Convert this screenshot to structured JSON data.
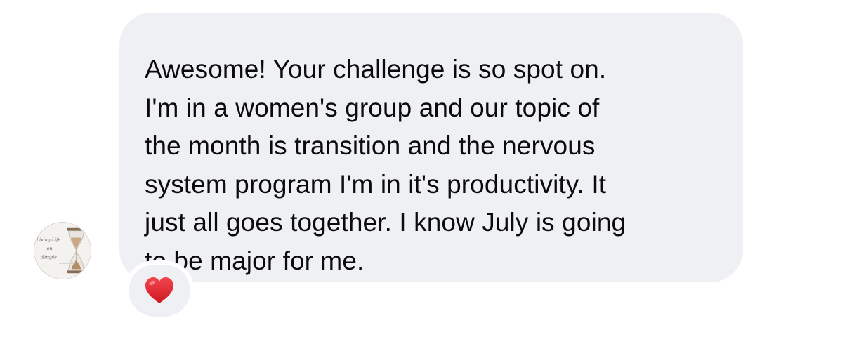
{
  "message": {
    "lines": [
      "Awesome! Your challenge is so spot on.",
      "I'm in a women's group and our topic of",
      "the month is transition and the nervous",
      "system program I'm in it's productivity. It",
      "just all goes together. I know July is going",
      "to be major for me."
    ]
  },
  "avatar": {
    "icon": "hourglass-logo-icon",
    "logo_text": [
      "Living Life",
      "on",
      "Simple"
    ]
  },
  "reaction": {
    "icon": "red-heart-icon",
    "color": "#e0202a"
  },
  "colors": {
    "bubble": "#eff0f3",
    "text": "#0b0b0d"
  }
}
